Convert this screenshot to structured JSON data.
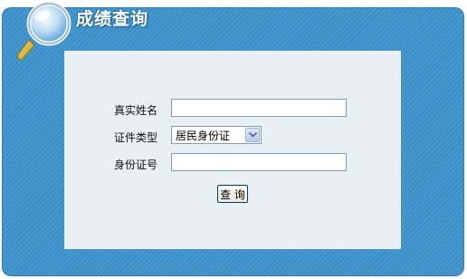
{
  "header": {
    "title": "成绩查询",
    "icon": "magnifier-icon"
  },
  "form": {
    "name_label": "真实姓名",
    "name_value": "",
    "id_type_label": "证件类型",
    "id_type_selected": "居民身份证",
    "id_number_label": "身份证号",
    "id_number_value": "",
    "submit_label": "查 询"
  },
  "colors": {
    "frame": "#3d93cc",
    "panel": "#e9f0f3",
    "input_border": "#7f9db9"
  }
}
